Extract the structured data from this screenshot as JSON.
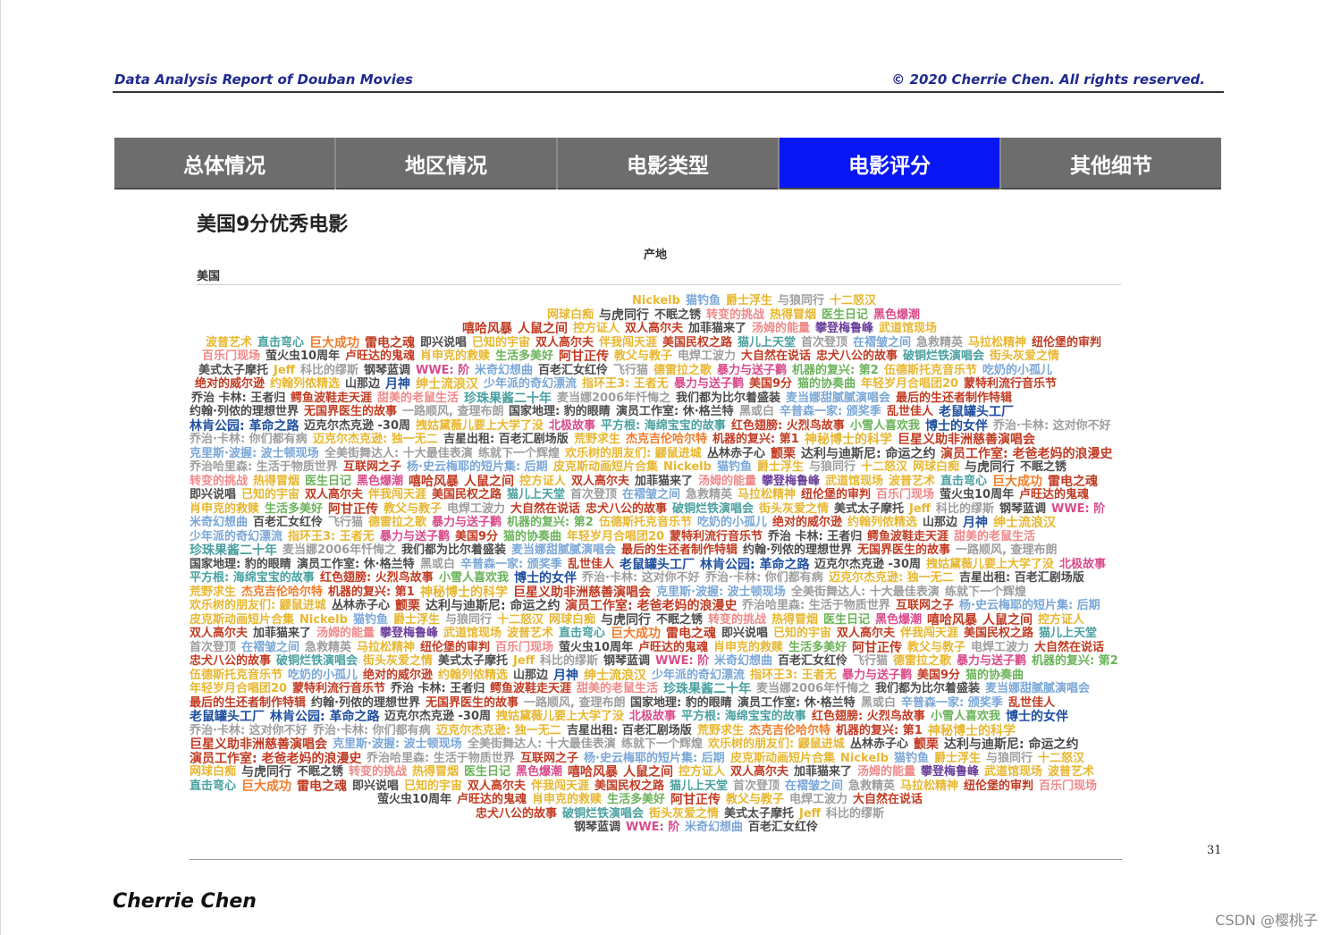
{
  "header": {
    "left": "Data Analysis Report of Douban Movies",
    "right": "© 2020 Cherrie Chen. All rights reserved."
  },
  "tabs": [
    {
      "label": "总体情况",
      "active": false
    },
    {
      "label": "地区情况",
      "active": false
    },
    {
      "label": "电影类型",
      "active": false
    },
    {
      "label": "电影评分",
      "active": true
    },
    {
      "label": "其他细节",
      "active": false
    }
  ],
  "viz": {
    "title": "美国9分优秀电影",
    "column_label": "产地",
    "row_label": "美国"
  },
  "footer": {
    "page_number": "31",
    "author": "Cherrie Chen",
    "watermark": "CSDN @樱桃子"
  },
  "colors": {
    "active_tab": "#0a17f5",
    "tab": "#6d6d6d",
    "header_text": "#1f2a8f"
  },
  "cloud_words": [
    {
      "t": "Nickelb",
      "c": "#e8b730",
      "s": 13
    },
    {
      "t": "猫钓鱼",
      "c": "#7aa7d8",
      "s": 13
    },
    {
      "t": "爵士浮生",
      "c": "#e8b730",
      "s": 13
    },
    {
      "t": "与狼同行",
      "c": "#9e9e9e",
      "s": 13
    },
    {
      "t": "十二怒汉",
      "c": "#e8b730",
      "s": 13
    },
    {
      "t": "网球白痴",
      "c": "#e8b730",
      "s": 13
    },
    {
      "t": "与虎同行",
      "c": "#4b4b4b",
      "s": 14
    },
    {
      "t": "不眠之锈",
      "c": "#4b4b4b",
      "s": 13
    },
    {
      "t": "转变的挑战",
      "c": "#f08a8a",
      "s": 13
    },
    {
      "t": "热得冒烟",
      "c": "#e8b730",
      "s": 13
    },
    {
      "t": "医生日记",
      "c": "#6bb35a",
      "s": 13
    },
    {
      "t": "黑色爆潮",
      "c": "#d94c8c",
      "s": 13
    },
    {
      "t": "嘻哈风暴",
      "c": "#c23b22",
      "s": 14
    },
    {
      "t": "人鼠之间",
      "c": "#c23b22",
      "s": 14
    },
    {
      "t": "控方证人",
      "c": "#e8b730",
      "s": 13
    },
    {
      "t": "双人高尔夫",
      "c": "#c23b22",
      "s": 13
    },
    {
      "t": "加菲猫来了",
      "c": "#4b4b4b",
      "s": 13
    },
    {
      "t": "汤姆的能量",
      "c": "#f08a8a",
      "s": 13
    },
    {
      "t": "攀登梅鲁峰",
      "c": "#6a3d9a",
      "s": 13
    },
    {
      "t": "武道馆现场",
      "c": "#e8b730",
      "s": 13
    },
    {
      "t": "波普艺术",
      "c": "#e8b730",
      "s": 13
    },
    {
      "t": "直击弯心",
      "c": "#4aa0a0",
      "s": 13
    },
    {
      "t": "巨大成功",
      "c": "#f07c2a",
      "s": 14
    },
    {
      "t": "雷电之魂",
      "c": "#c23b22",
      "s": 14
    },
    {
      "t": "即兴说唱",
      "c": "#4b4b4b",
      "s": 13
    },
    {
      "t": "已知的宇宙",
      "c": "#e8b730",
      "s": 13
    },
    {
      "t": "双人高尔夫",
      "c": "#c23b22",
      "s": 13
    },
    {
      "t": "伴我闯天涯",
      "c": "#e8b730",
      "s": 13
    },
    {
      "t": "美国民权之路",
      "c": "#c23b22",
      "s": 13
    },
    {
      "t": "猫儿上天堂",
      "c": "#4aa0a0",
      "s": 13
    },
    {
      "t": "首次登顶",
      "c": "#9e9e9e",
      "s": 13
    },
    {
      "t": "在褶皱之间",
      "c": "#7aa7d8",
      "s": 13
    },
    {
      "t": "急救精英",
      "c": "#9e9e9e",
      "s": 13
    },
    {
      "t": "马拉松精神",
      "c": "#e8b730",
      "s": 13
    },
    {
      "t": "纽伦堡的审判",
      "c": "#c23b22",
      "s": 13
    },
    {
      "t": "百乐门现场",
      "c": "#f08a8a",
      "s": 13
    },
    {
      "t": "萤火虫10周年",
      "c": "#4b4b4b",
      "s": 13
    },
    {
      "t": "卢旺达的鬼魂",
      "c": "#c23b22",
      "s": 13
    },
    {
      "t": "肖申克的救赎",
      "c": "#e8b730",
      "s": 13
    },
    {
      "t": "生活多美好",
      "c": "#6bb35a",
      "s": 13
    },
    {
      "t": "阿甘正传",
      "c": "#c23b22",
      "s": 14
    },
    {
      "t": "教父与教子",
      "c": "#e8b730",
      "s": 13
    },
    {
      "t": "电焊工波力",
      "c": "#9e9e9e",
      "s": 13
    },
    {
      "t": "大自然在说话",
      "c": "#c23b22",
      "s": 13
    },
    {
      "t": "忠犬八公的故事",
      "c": "#c23b22",
      "s": 13
    },
    {
      "t": "破铜烂铁演唱会",
      "c": "#4aa0a0",
      "s": 13
    },
    {
      "t": "街头灰爱之情",
      "c": "#e8b730",
      "s": 13
    },
    {
      "t": "美式太子摩托",
      "c": "#4b4b4b",
      "s": 13
    },
    {
      "t": "Jeff",
      "c": "#e8b730",
      "s": 13
    },
    {
      "t": "科比的缪斯",
      "c": "#9e9e9e",
      "s": 13
    },
    {
      "t": "钢琴蓝调",
      "c": "#4b4b4b",
      "s": 13
    },
    {
      "t": "WWE: 阶",
      "c": "#d94c8c",
      "s": 13
    },
    {
      "t": "米奇幻想曲",
      "c": "#7aa7d8",
      "s": 13
    },
    {
      "t": "百老汇女红伶",
      "c": "#4b4b4b",
      "s": 13
    },
    {
      "t": "飞行猫",
      "c": "#9e9e9e",
      "s": 13
    },
    {
      "t": "德雷拉之歌",
      "c": "#e8b730",
      "s": 13
    },
    {
      "t": "暴力与送子鹳",
      "c": "#d94c8c",
      "s": 13
    },
    {
      "t": "机器的复兴: 第2",
      "c": "#6bb35a",
      "s": 13
    },
    {
      "t": "伍德斯托克音乐节",
      "c": "#e8b730",
      "s": 13
    },
    {
      "t": "吃奶的小孤儿",
      "c": "#7aa7d8",
      "s": 13
    },
    {
      "t": "绝对的威尔逊",
      "c": "#c23b22",
      "s": 13
    },
    {
      "t": "约翰列侬精选",
      "c": "#e8b730",
      "s": 13
    },
    {
      "t": "山那边",
      "c": "#4b4b4b",
      "s": 13
    },
    {
      "t": "月神",
      "c": "#1f4fa0",
      "s": 14
    },
    {
      "t": "绅士流浪汉",
      "c": "#e8b730",
      "s": 14
    },
    {
      "t": "少年派的奇幻漂流",
      "c": "#7aa7d8",
      "s": 13
    },
    {
      "t": "指环王3: 王者无",
      "c": "#e8b730",
      "s": 13
    },
    {
      "t": "暴力与送子鹳",
      "c": "#d94c8c",
      "s": 13
    },
    {
      "t": "美国9分",
      "c": "#c23b22",
      "s": 13
    },
    {
      "t": "猫的协奏曲",
      "c": "#6bb35a",
      "s": 13
    },
    {
      "t": "年轻岁月合唱团20",
      "c": "#e8b730",
      "s": 13
    },
    {
      "t": "蒙特利流行音乐节",
      "c": "#c23b22",
      "s": 13
    },
    {
      "t": "乔治 卡林: 王者归",
      "c": "#4b4b4b",
      "s": 13
    },
    {
      "t": "鳄鱼波鞋走天涯",
      "c": "#c23b22",
      "s": 13
    },
    {
      "t": "甜美的老鼠生活",
      "c": "#f08a8a",
      "s": 13
    },
    {
      "t": "珍珠果酱二十年",
      "c": "#4aa0a0",
      "s": 14
    },
    {
      "t": "麦当娜2006年忏悔之",
      "c": "#9e9e9e",
      "s": 13
    },
    {
      "t": "我们都为比尔着盛装",
      "c": "#4b4b4b",
      "s": 13
    },
    {
      "t": "麦当娜甜腻腻演唱会",
      "c": "#7aa7d8",
      "s": 13
    },
    {
      "t": "最后的生还者制作特辑",
      "c": "#c23b22",
      "s": 13
    },
    {
      "t": "约翰·列侬的理想世界",
      "c": "#4b4b4b",
      "s": 13
    },
    {
      "t": "无国界医生的故事",
      "c": "#c23b22",
      "s": 13
    },
    {
      "t": "一路顺风, 查理布朗",
      "c": "#9e9e9e",
      "s": 13
    },
    {
      "t": "国家地理: 豹的眼睛",
      "c": "#4b4b4b",
      "s": 13
    },
    {
      "t": "演员工作室: 休·格兰特",
      "c": "#4b4b4b",
      "s": 13
    },
    {
      "t": "黑或白",
      "c": "#9e9e9e",
      "s": 13
    },
    {
      "t": "辛普森一家: 颁奖季",
      "c": "#7aa7d8",
      "s": 13
    },
    {
      "t": "乱世佳人",
      "c": "#c23b22",
      "s": 13
    },
    {
      "t": "老鼠罐头工厂",
      "c": "#1f4fa0",
      "s": 14
    },
    {
      "t": "林肯公园: 革命之路",
      "c": "#1f4fa0",
      "s": 14
    },
    {
      "t": "迈克尔杰克逊 -30周",
      "c": "#4b4b4b",
      "s": 13
    },
    {
      "t": "拽姑黛薇儿要上大学了没",
      "c": "#e8b730",
      "s": 13
    },
    {
      "t": "北极故事",
      "c": "#d94c8c",
      "s": 13
    },
    {
      "t": "平方根: 海绵宝宝的故事",
      "c": "#4aa0a0",
      "s": 13
    },
    {
      "t": "红色翅膀: 火烈鸟故事",
      "c": "#c23b22",
      "s": 13
    },
    {
      "t": "小雪人喜欢我",
      "c": "#6bb35a",
      "s": 13
    },
    {
      "t": "博士的女伴",
      "c": "#1f4fa0",
      "s": 14
    },
    {
      "t": "乔治·卡林: 这对你不好",
      "c": "#9e9e9e",
      "s": 13
    },
    {
      "t": "乔治·卡林: 你们都有病",
      "c": "#9e9e9e",
      "s": 13
    },
    {
      "t": "迈克尔杰克逊: 独一无二",
      "c": "#e8b730",
      "s": 13
    },
    {
      "t": "吉星出租: 百老汇剧场版",
      "c": "#4b4b4b",
      "s": 13
    },
    {
      "t": "荒野求生",
      "c": "#e8b730",
      "s": 13
    },
    {
      "t": "杰克吉伦哈尔特",
      "c": "#f07c2a",
      "s": 13
    },
    {
      "t": "机器的复兴: 第1",
      "c": "#c23b22",
      "s": 13
    },
    {
      "t": "神秘博士的科学",
      "c": "#e8b730",
      "s": 14
    },
    {
      "t": "巨星义助非洲慈善演唱会",
      "c": "#c23b22",
      "s": 14
    },
    {
      "t": "克里斯·波握: 波士顿现场",
      "c": "#7aa7d8",
      "s": 13
    },
    {
      "t": "全美街舞达人: 十大最佳表演",
      "c": "#9e9e9e",
      "s": 13
    },
    {
      "t": "练就下一个辉煌",
      "c": "#9e9e9e",
      "s": 13
    },
    {
      "t": "欢乐树的朋友们: 鼹鼠进城",
      "c": "#e8b730",
      "s": 13
    },
    {
      "t": "丛林赤子心",
      "c": "#4b4b4b",
      "s": 13
    },
    {
      "t": "颤栗",
      "c": "#c23b22",
      "s": 14
    },
    {
      "t": "达利与迪斯尼: 命运之约",
      "c": "#4b4b4b",
      "s": 14
    },
    {
      "t": "演员工作室: 老爸老妈的浪漫史",
      "c": "#c23b22",
      "s": 14
    },
    {
      "t": "乔治哈里森: 生活于物质世界",
      "c": "#9e9e9e",
      "s": 13
    },
    {
      "t": "互联网之子",
      "c": "#c23b22",
      "s": 13
    },
    {
      "t": "杨·史云梅耶的短片集: 后期",
      "c": "#7aa7d8",
      "s": 13
    },
    {
      "t": "皮克斯动画短片合集",
      "c": "#e8b730",
      "s": 13
    }
  ]
}
